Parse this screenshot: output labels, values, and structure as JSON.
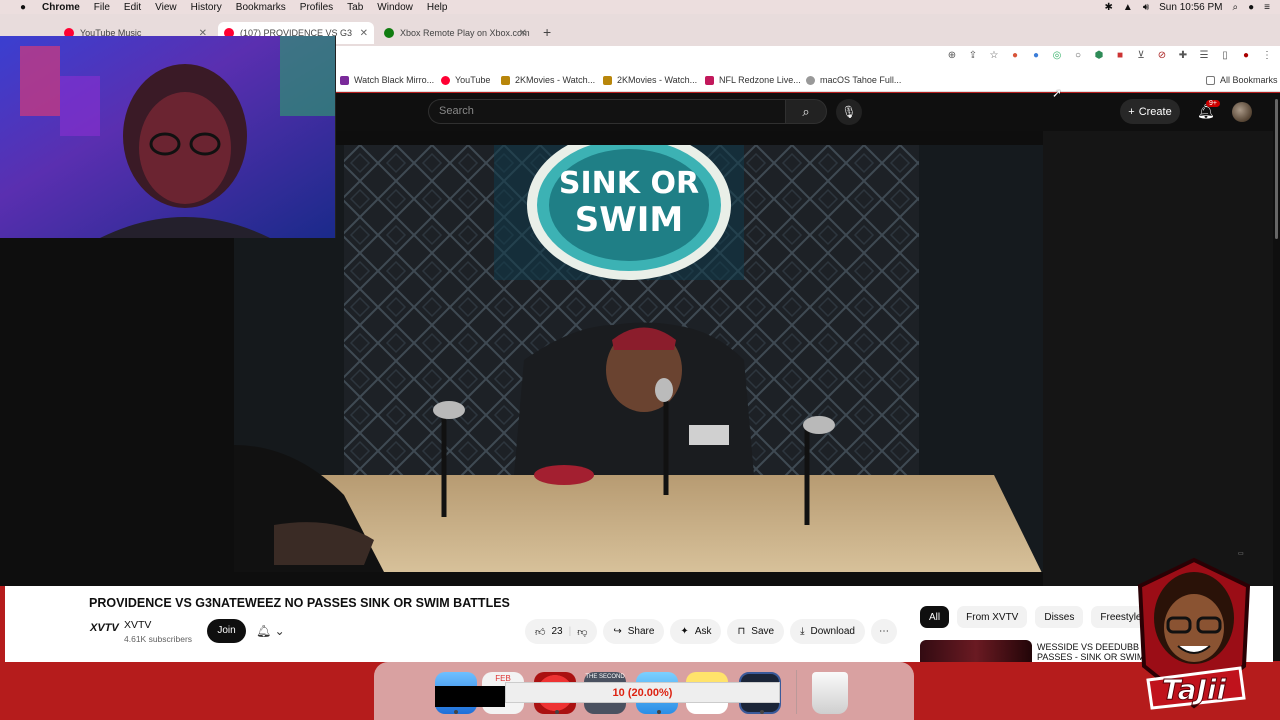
{
  "menubar": {
    "apple": "",
    "app": "Chrome",
    "items": [
      "File",
      "Edit",
      "View",
      "History",
      "Bookmarks",
      "Profiles",
      "Tab",
      "Window",
      "Help"
    ],
    "clock": "Sun 10:56 PM"
  },
  "tabs": [
    {
      "label": "YouTube Music",
      "color": "#ff0033"
    },
    {
      "label": "(107) PROVIDENCE VS G3",
      "color": "#ff0033",
      "active": true
    },
    {
      "label": "Xbox Remote Play on Xbox.com",
      "color": "#107c10"
    }
  ],
  "bookmarks": [
    {
      "label": "Watch Black Mirro...",
      "color": "#7a2a9a"
    },
    {
      "label": "YouTube",
      "color": "#ff0033"
    },
    {
      "label": "2KMovies - Watch...",
      "color": "#b8860b"
    },
    {
      "label": "2KMovies - Watch...",
      "color": "#b8860b"
    },
    {
      "label": "NFL Redzone Live...",
      "color": "#c2185b"
    },
    {
      "label": "macOS Tahoe Full...",
      "color": "#999999"
    }
  ],
  "all_bookmarks": "All Bookmarks",
  "youtube": {
    "search_placeholder": "Search",
    "create_label": "Create",
    "notif_badge": "9+"
  },
  "video": {
    "sign_line1": "SINK OR",
    "sign_line2": "SWIM",
    "title": "PROVIDENCE VS G3NATEWEEZ NO PASSES SINK OR SWIM BATTLES",
    "channel_logo": "XVTV",
    "channel": "XVTV",
    "subscribers": "4.61K subscribers",
    "join": "Join",
    "likes": "23",
    "share": "Share",
    "ask": "Ask",
    "save": "Save",
    "download": "Download"
  },
  "chips": [
    "All",
    "From XVTV",
    "Disses",
    "Freestyle Rap"
  ],
  "recommendation": {
    "line1": "WESSIDE VS DEEDUBB N",
    "line2": "PASSES - SINK OR SWIM"
  },
  "dock": {
    "progress_text": "10 (20.00%)",
    "icon_feb": "FEB",
    "icon_second": "THE SECOND"
  },
  "streamer_logo": "TaJii",
  "colors": {
    "youtube_red": "#ff0033",
    "dark_bg": "#0f0f0f",
    "desktop_red": "#b51c1c"
  }
}
